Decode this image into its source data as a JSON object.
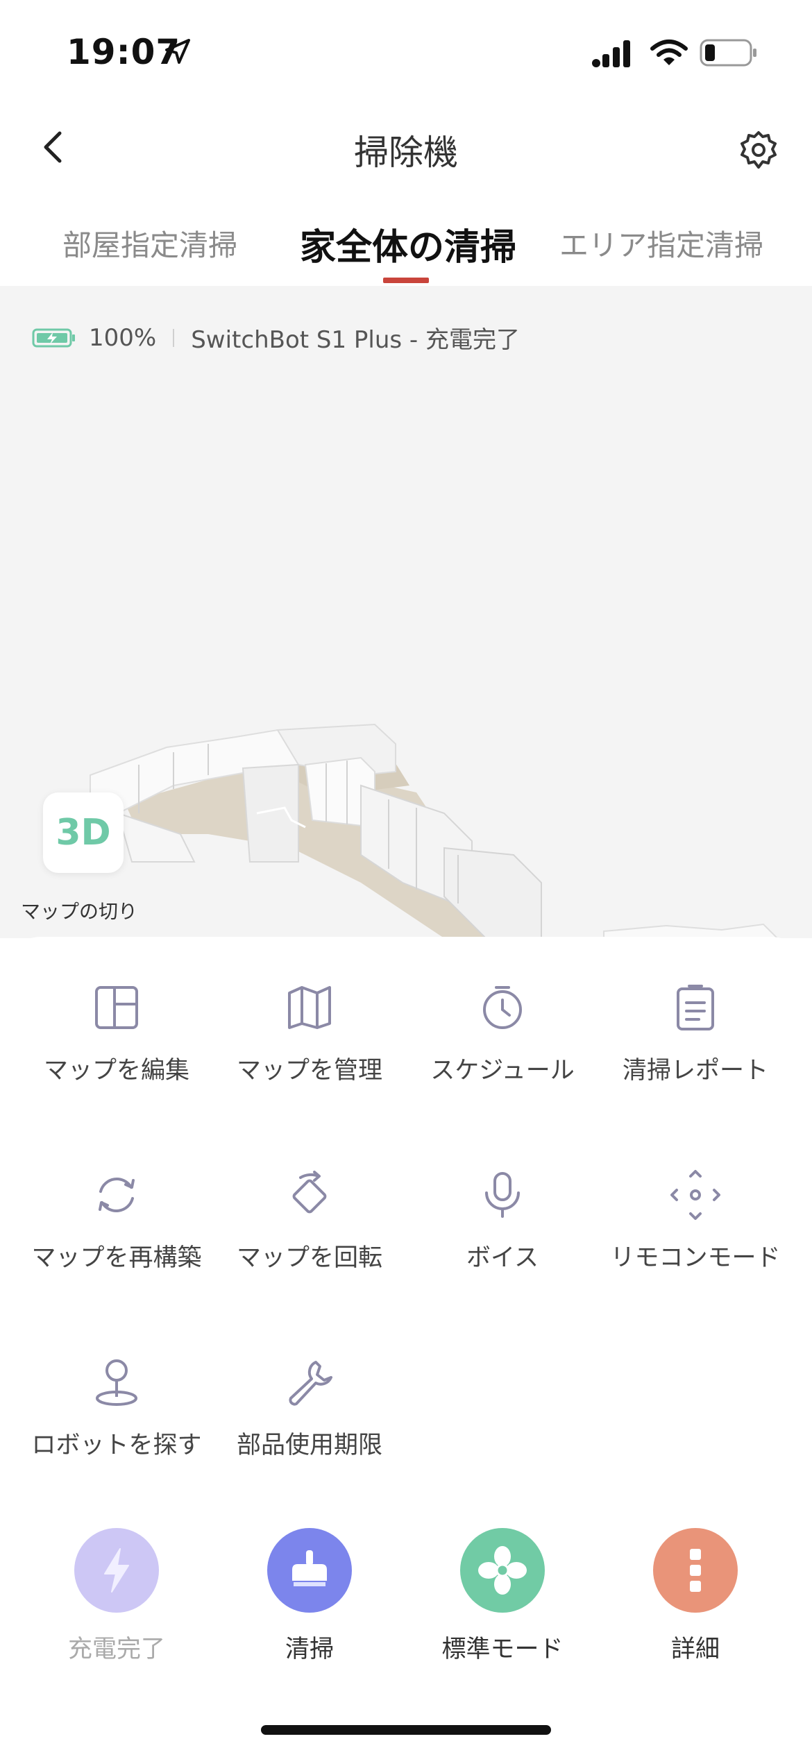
{
  "status_bar": {
    "time": "19:07"
  },
  "header": {
    "title": "掃除機"
  },
  "tabs": [
    {
      "label": "部屋指定清掃",
      "active": false
    },
    {
      "label": "家全体の清掃",
      "active": true
    },
    {
      "label": "エリア指定清掃",
      "active": false
    }
  ],
  "status_row": {
    "battery": "100%",
    "device_status": "SwitchBot S1 Plus - 充電完了"
  },
  "map": {
    "view_toggle": "3D",
    "switch_label": "マップの切り"
  },
  "grid": [
    {
      "label": "マップを編集",
      "icon": "map-edit-icon"
    },
    {
      "label": "マップを管理",
      "icon": "map-manage-icon"
    },
    {
      "label": "スケジュール",
      "icon": "clock-icon"
    },
    {
      "label": "清掃レポート",
      "icon": "report-icon"
    },
    {
      "label": "マップを再構築",
      "icon": "refresh-icon"
    },
    {
      "label": "マップを回転",
      "icon": "rotate-icon"
    },
    {
      "label": "ボイス",
      "icon": "microphone-icon"
    },
    {
      "label": "リモコンモード",
      "icon": "move-icon"
    },
    {
      "label": "ロボットを探す",
      "icon": "location-pin-icon"
    },
    {
      "label": "部品使用期限",
      "icon": "wrench-icon"
    }
  ],
  "actions": [
    {
      "label": "充電完了",
      "color": "#cdc7f5",
      "icon": "lightning-icon"
    },
    {
      "label": "清掃",
      "color": "#7c85ec",
      "icon": "broom-icon"
    },
    {
      "label": "標準モード",
      "color": "#71cba5",
      "icon": "fan-icon"
    },
    {
      "label": "詳細",
      "color": "#e99479",
      "icon": "more-icon"
    }
  ],
  "colors": {
    "accent": "#c9443b",
    "icon_gray": "#8b89a6"
  }
}
